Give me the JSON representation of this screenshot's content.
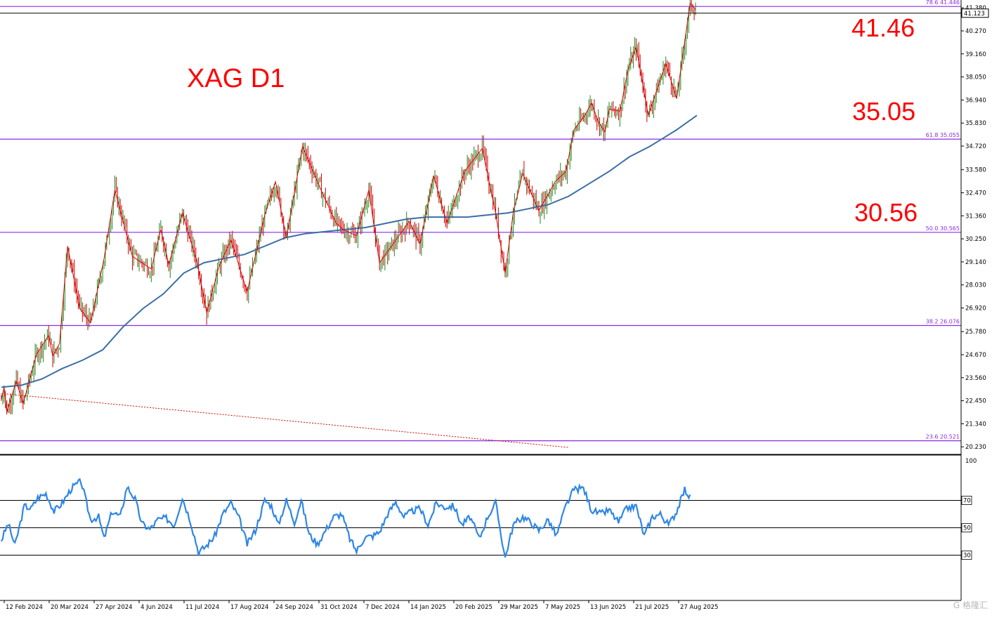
{
  "chart_data": {
    "type": "candlestick",
    "symbol_timeframe": "XAG D1",
    "price_axis": {
      "min": 19.9,
      "max": 41.69,
      "ticks": [
        "41.380",
        "40.270",
        "39.160",
        "38.050",
        "36.940",
        "35.830",
        "34.720",
        "33.580",
        "32.470",
        "31.360",
        "30.250",
        "29.140",
        "28.030",
        "26.920",
        "25.780",
        "24.670",
        "23.560",
        "22.450",
        "21.340",
        "20.230"
      ],
      "current_price_label": "41.123",
      "current_price": 41.123
    },
    "time_axis": {
      "labels": [
        "12 Feb 2024",
        "20 Mar 2024",
        "27 Apr 2024",
        "4 Jun 2024",
        "11 Jul 2024",
        "17 Aug 2024",
        "24 Sep 2024",
        "31 Oct 2024",
        "7 Dec 2024",
        "14 Jan 2025",
        "20 Feb 2025",
        "29 Mar 2025",
        "7 May 2025",
        "13 Jun 2025",
        "21 Jul 2025",
        "27 Aug 2025"
      ]
    },
    "fib_levels": [
      {
        "label": "78.6 41.446",
        "value": 41.446
      },
      {
        "label": "61.8 35.055",
        "value": 35.055
      },
      {
        "label": "50.0 30.565",
        "value": 30.565
      },
      {
        "label": "38.2 26.076",
        "value": 26.076
      },
      {
        "label": "23.6 20.521",
        "value": 20.521
      }
    ],
    "annotations": [
      "41.46",
      "35.05",
      "30.56"
    ],
    "zigzag": [
      [
        0,
        22.5
      ],
      [
        2,
        23.1
      ],
      [
        4,
        21.9
      ],
      [
        11,
        23.4
      ],
      [
        16,
        22.3
      ],
      [
        26,
        24.7
      ],
      [
        35,
        25.6
      ],
      [
        38,
        24.6
      ],
      [
        43,
        25.2
      ],
      [
        49,
        29.9
      ],
      [
        58,
        26.9
      ],
      [
        66,
        26.2
      ],
      [
        76,
        29.3
      ],
      [
        84,
        32.6
      ],
      [
        97,
        29.4
      ],
      [
        111,
        28.8
      ],
      [
        118,
        30.7
      ],
      [
        124,
        29.0
      ],
      [
        134,
        31.5
      ],
      [
        145,
        29.1
      ],
      [
        152,
        26.7
      ],
      [
        161,
        28.9
      ],
      [
        170,
        30.2
      ],
      [
        182,
        27.7
      ],
      [
        195,
        31.4
      ],
      [
        203,
        33.0
      ],
      [
        211,
        30.3
      ],
      [
        223,
        34.7
      ],
      [
        238,
        32.4
      ],
      [
        248,
        31.0
      ],
      [
        253,
        30.7
      ],
      [
        263,
        30.4
      ],
      [
        272,
        32.6
      ],
      [
        280,
        29.1
      ],
      [
        290,
        30.0
      ],
      [
        302,
        31.1
      ],
      [
        310,
        30.0
      ],
      [
        320,
        33.3
      ],
      [
        330,
        31.0
      ],
      [
        343,
        33.5
      ],
      [
        356,
        34.6
      ],
      [
        366,
        31.5
      ],
      [
        373,
        28.6
      ],
      [
        379,
        31.5
      ],
      [
        386,
        33.4
      ],
      [
        398,
        31.6
      ],
      [
        410,
        33.0
      ],
      [
        418,
        33.5
      ],
      [
        424,
        35.5
      ],
      [
        432,
        36.2
      ],
      [
        437,
        36.8
      ],
      [
        442,
        35.9
      ],
      [
        447,
        35.4
      ],
      [
        450,
        36.5
      ],
      [
        458,
        36.4
      ],
      [
        464,
        38.4
      ],
      [
        470,
        39.5
      ],
      [
        479,
        36.2
      ],
      [
        492,
        38.7
      ],
      [
        500,
        37.0
      ],
      [
        510,
        41.6
      ],
      [
        514,
        41.3
      ]
    ],
    "ma_period_points": [
      [
        0,
        23.1
      ],
      [
        15,
        23.2
      ],
      [
        30,
        23.5
      ],
      [
        45,
        24.0
      ],
      [
        60,
        24.4
      ],
      [
        75,
        24.9
      ],
      [
        90,
        26.0
      ],
      [
        105,
        26.9
      ],
      [
        120,
        27.6
      ],
      [
        135,
        28.6
      ],
      [
        150,
        29.1
      ],
      [
        165,
        29.3
      ],
      [
        180,
        29.5
      ],
      [
        195,
        29.9
      ],
      [
        210,
        30.3
      ],
      [
        225,
        30.5
      ],
      [
        240,
        30.6
      ],
      [
        255,
        30.7
      ],
      [
        270,
        30.8
      ],
      [
        285,
        31.0
      ],
      [
        300,
        31.2
      ],
      [
        315,
        31.3
      ],
      [
        330,
        31.3
      ],
      [
        345,
        31.3
      ],
      [
        360,
        31.4
      ],
      [
        375,
        31.5
      ],
      [
        390,
        31.7
      ],
      [
        405,
        31.9
      ],
      [
        420,
        32.3
      ],
      [
        435,
        32.9
      ],
      [
        450,
        33.5
      ],
      [
        465,
        34.2
      ],
      [
        480,
        34.7
      ],
      [
        490,
        35.1
      ],
      [
        500,
        35.5
      ],
      [
        515,
        36.2
      ]
    ],
    "trendline": {
      "from": [
        0,
        22.8
      ],
      "to": [
        420,
        20.2
      ]
    },
    "rsi": {
      "levels": [
        "70",
        "50",
        "30"
      ],
      "scale_top": "100",
      "points": [
        [
          0,
          41
        ],
        [
          5,
          53
        ],
        [
          10,
          37
        ],
        [
          17,
          66
        ],
        [
          22,
          64
        ],
        [
          27,
          72
        ],
        [
          33,
          75
        ],
        [
          39,
          62
        ],
        [
          45,
          68
        ],
        [
          52,
          79
        ],
        [
          59,
          84
        ],
        [
          66,
          56
        ],
        [
          72,
          58
        ],
        [
          76,
          42
        ],
        [
          82,
          62
        ],
        [
          88,
          58
        ],
        [
          93,
          80
        ],
        [
          99,
          71
        ],
        [
          104,
          53
        ],
        [
          110,
          49
        ],
        [
          116,
          56
        ],
        [
          122,
          57
        ],
        [
          128,
          52
        ],
        [
          134,
          72
        ],
        [
          140,
          55
        ],
        [
          146,
          32
        ],
        [
          152,
          37
        ],
        [
          158,
          44
        ],
        [
          164,
          60
        ],
        [
          170,
          68
        ],
        [
          176,
          57
        ],
        [
          182,
          38
        ],
        [
          188,
          48
        ],
        [
          195,
          70
        ],
        [
          200,
          66
        ],
        [
          205,
          52
        ],
        [
          211,
          70
        ],
        [
          217,
          54
        ],
        [
          222,
          70
        ],
        [
          228,
          45
        ],
        [
          234,
          38
        ],
        [
          240,
          48
        ],
        [
          246,
          58
        ],
        [
          252,
          60
        ],
        [
          258,
          42
        ],
        [
          263,
          33
        ],
        [
          269,
          43
        ],
        [
          275,
          44
        ],
        [
          280,
          47
        ],
        [
          286,
          60
        ],
        [
          292,
          69
        ],
        [
          298,
          58
        ],
        [
          304,
          62
        ],
        [
          310,
          64
        ],
        [
          316,
          52
        ],
        [
          322,
          68
        ],
        [
          328,
          65
        ],
        [
          335,
          66
        ],
        [
          341,
          52
        ],
        [
          347,
          58
        ],
        [
          354,
          42
        ],
        [
          360,
          58
        ],
        [
          366,
          68
        ],
        [
          373,
          28
        ],
        [
          379,
          52
        ],
        [
          386,
          58
        ],
        [
          392,
          54
        ],
        [
          398,
          48
        ],
        [
          405,
          56
        ],
        [
          411,
          44
        ],
        [
          418,
          66
        ],
        [
          424,
          78
        ],
        [
          431,
          79
        ],
        [
          437,
          63
        ],
        [
          444,
          60
        ],
        [
          450,
          63
        ],
        [
          457,
          54
        ],
        [
          463,
          64
        ],
        [
          470,
          66
        ],
        [
          476,
          44
        ],
        [
          482,
          58
        ],
        [
          488,
          60
        ],
        [
          494,
          52
        ],
        [
          500,
          62
        ],
        [
          506,
          78
        ],
        [
          510,
          72
        ]
      ]
    }
  }
}
